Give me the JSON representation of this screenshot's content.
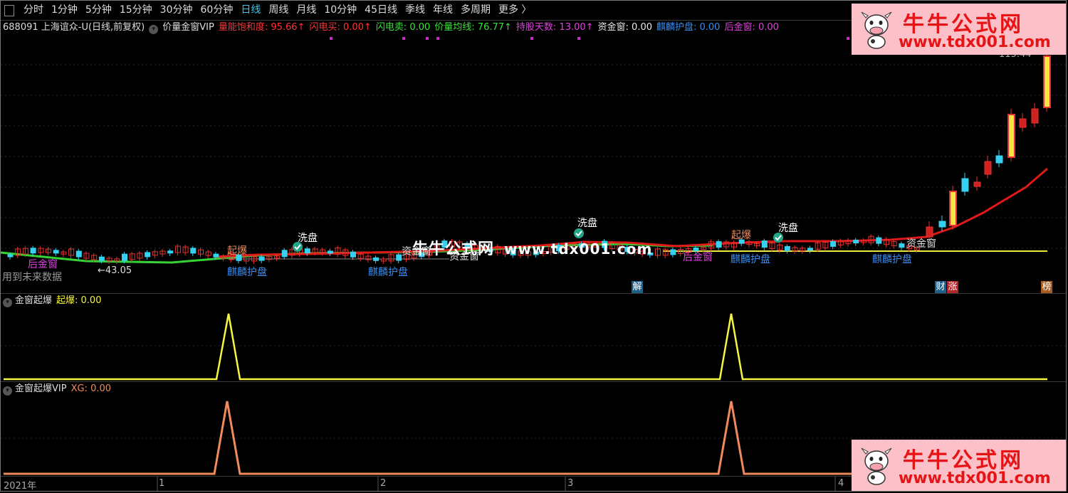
{
  "toolbar": {
    "periods": [
      "分时",
      "1分钟",
      "5分钟",
      "15分钟",
      "30分钟",
      "60分钟",
      "日线",
      "周线",
      "月线",
      "10分钟",
      "45日线",
      "季线",
      "年线",
      "多周期",
      "更多 〉"
    ],
    "active_period": "日线"
  },
  "header": {
    "stock": "688091 上海谊众-U(日线,前复权)",
    "indicator": "价量金窗VIP",
    "items": [
      {
        "label": "量能饱和度: 95.66",
        "arrow": "↑",
        "color": "#ff3333"
      },
      {
        "label": "闪电买: 0.00",
        "arrow": "↑",
        "color": "#ff3333"
      },
      {
        "label": "闪电卖: 0.00",
        "arrow": "",
        "color": "#33e833"
      },
      {
        "label": "价量均线: 76.77",
        "arrow": "↑",
        "color": "#33e833"
      },
      {
        "label": "持股天数: 13.00",
        "arrow": "↑",
        "color": "#e040e0"
      },
      {
        "label": "资金窗: 0.00",
        "arrow": "",
        "color": "#e8e8e8"
      },
      {
        "label": "麒麟护盘: 0.00",
        "arrow": "",
        "color": "#3a8cf0"
      },
      {
        "label": "后金窗: 0.00",
        "arrow": "",
        "color": "#e040e0"
      }
    ]
  },
  "main_chart": {
    "price_high_label": "115.44",
    "price_low_label": "←43.05",
    "future_data_note": "用到未来数据",
    "markers": {
      "xipan": "洗盘",
      "qibao": "起爆",
      "qilin": "麒麟护盘",
      "zijinchuang": "资金窗",
      "houjinchuang": "后金窗"
    },
    "badges": [
      "解",
      "财",
      "涨",
      "榜"
    ]
  },
  "pane2": {
    "name": "金窗起爆",
    "value_label": "起爆: 0.00",
    "line_color": "#f5f542"
  },
  "pane3": {
    "name": "金窗起爆VIP",
    "value_label": "XG: 0.00",
    "line_color": "#f08a5a"
  },
  "x_axis": {
    "labels": [
      "2021年",
      "1",
      "2",
      "3",
      "4"
    ]
  },
  "watermark": {
    "title": "牛牛公式网",
    "url": "www.tdx001.com",
    "center_title": "牛牛公式网",
    "center_url": "www.tdx001.com"
  }
}
